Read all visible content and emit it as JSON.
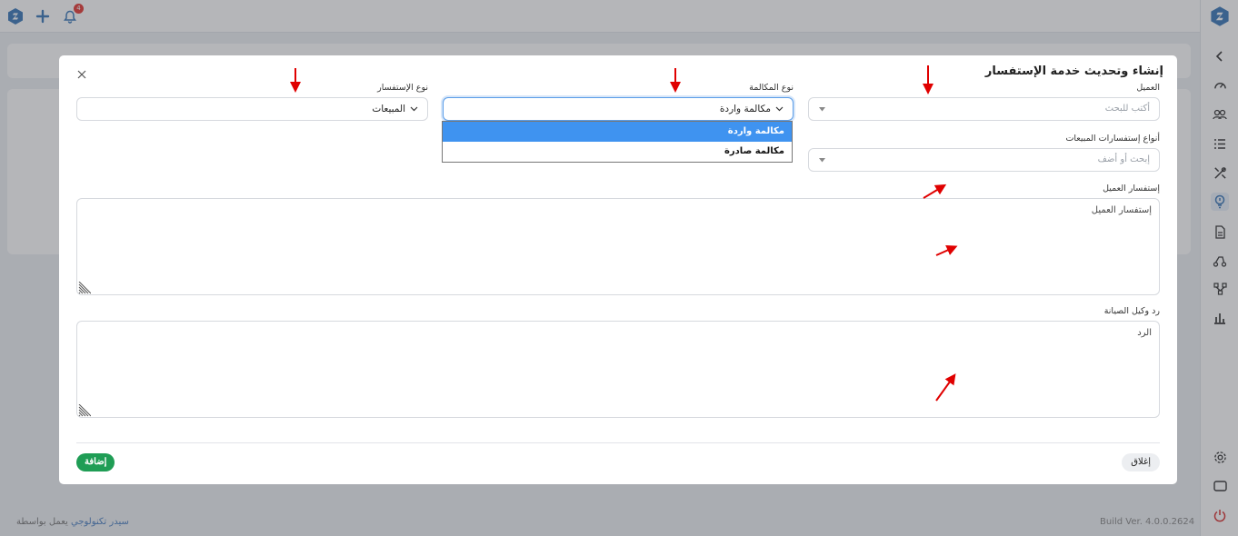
{
  "topbar": {
    "notification_count": "4"
  },
  "footer": {
    "powered_prefix": "يعمل بواسطة",
    "powered_link": "سيدر تكنولوجي",
    "build": "Build Ver. 4.0.0.2624"
  },
  "modal": {
    "title": "إنشاء وتحديث خدمة الإستفسار",
    "customer": {
      "label": "العميل",
      "placeholder": "أكتب للبحث"
    },
    "call_type": {
      "label": "نوع المكالمة",
      "value": "مكالمة واردة",
      "options": [
        "مكالمة واردة",
        "مكالمة صادرة"
      ],
      "selected_index": 0
    },
    "inquiry_type": {
      "label": "نوع الإستفسار",
      "value": "المبيعات"
    },
    "sales_inquiry_types": {
      "label": "أنواع إستفسارات المبيعات",
      "placeholder": "إبحث أو أضف"
    },
    "customer_inquiry": {
      "label": "إستفسار العميل",
      "placeholder": "إستفسار العميل"
    },
    "agent_reply": {
      "label": "رد وكيل الصيانة",
      "placeholder": "الرد"
    },
    "close_label": "إغلاق",
    "add_label": "إضافة"
  },
  "colors": {
    "primary": "#3f93f0",
    "success": "#1f9d55",
    "danger": "#e53935",
    "annotation_arrow": "#e00000"
  }
}
